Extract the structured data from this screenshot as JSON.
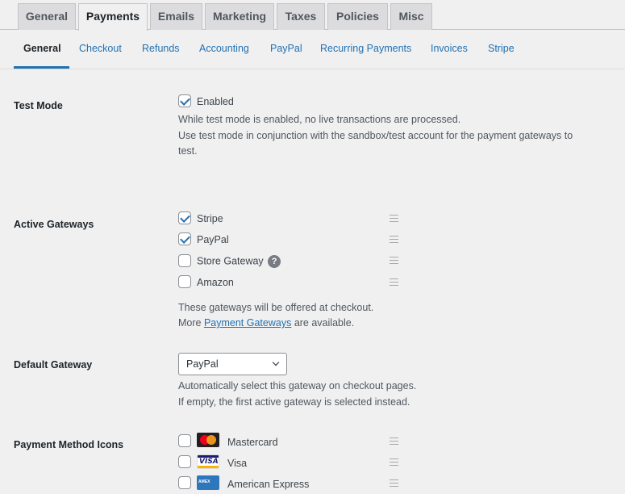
{
  "top_tabs": [
    "General",
    "Payments",
    "Emails",
    "Marketing",
    "Taxes",
    "Policies",
    "Misc"
  ],
  "top_tab_active": "Payments",
  "sub_tabs": [
    "General",
    "Checkout",
    "Refunds",
    "Accounting",
    "PayPal",
    "Recurring Payments",
    "Invoices",
    "Stripe"
  ],
  "sub_tab_active": "General",
  "test_mode": {
    "label": "Test Mode",
    "checkbox_label": "Enabled",
    "checked": true,
    "desc1": "While test mode is enabled, no live transactions are processed.",
    "desc2": "Use test mode in conjunction with the sandbox/test account for the payment gateways to",
    "desc3": "test."
  },
  "active_gateways": {
    "label": "Active Gateways",
    "items": [
      {
        "name": "Stripe",
        "checked": true
      },
      {
        "name": "PayPal",
        "checked": true
      },
      {
        "name": "Store Gateway",
        "checked": false,
        "help": "?"
      },
      {
        "name": "Amazon",
        "checked": false
      }
    ],
    "desc1": "These gateways will be offered at checkout.",
    "desc2_prefix": "More ",
    "desc2_link": "Payment Gateways",
    "desc2_suffix": " are available."
  },
  "default_gateway": {
    "label": "Default Gateway",
    "selected": "PayPal",
    "desc1": "Automatically select this gateway on checkout pages.",
    "desc2": "If empty, the first active gateway is selected instead."
  },
  "payment_method_icons": {
    "label": "Payment Method Icons",
    "items": [
      {
        "name": "Mastercard",
        "checked": false,
        "icon": "mastercard-logo",
        "icon_text": "mastercard"
      },
      {
        "name": "Visa",
        "checked": false,
        "icon": "visa-logo",
        "icon_text": "VISA"
      },
      {
        "name": "American Express",
        "checked": false,
        "icon": "amex-logo",
        "icon_text": "AMERICAN EXPRESS"
      }
    ]
  },
  "colors": {
    "accent": "#2271b1",
    "background": "#f0f0f1",
    "tab_inactive": "#dcdcde"
  }
}
